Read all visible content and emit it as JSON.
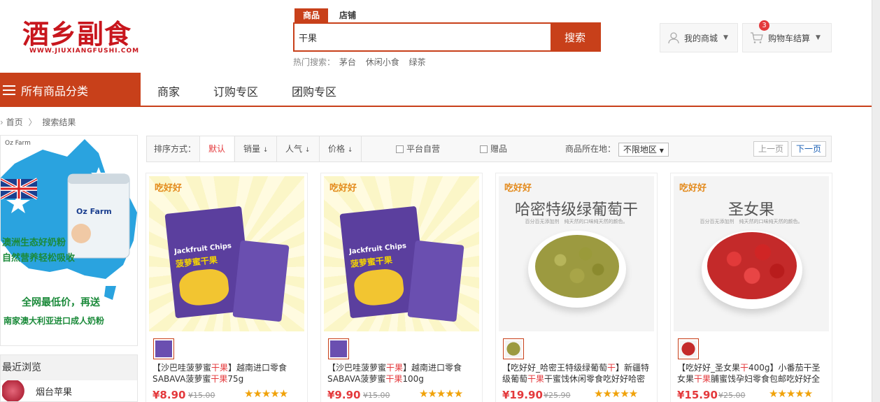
{
  "logo": {
    "text": "酒乡副食",
    "url": "WWW.JIUXIANGFUSHI.COM"
  },
  "search": {
    "tabs": [
      "商品",
      "店铺"
    ],
    "value": "干果",
    "button": "搜索",
    "hot_label": "热门搜索：",
    "hot_terms": [
      "茅台",
      "休闲小食",
      "绿茶"
    ]
  },
  "header": {
    "my_mall": "我的商城",
    "cart": "购物车结算",
    "cart_count": "3"
  },
  "nav": {
    "all_categories": "所有商品分类",
    "items": [
      "商家",
      "订购专区",
      "团购专区"
    ]
  },
  "breadcrumb": {
    "home": "首页",
    "current": "搜索结果"
  },
  "sidebar": {
    "ad": {
      "brand": "Oz Farm",
      "can_brand": "Oz Farm",
      "line1": "澳洲生态好奶粉",
      "line2": "自然营养轻松吸收",
      "line3": "全网最低价，再送",
      "line4": "南家澳大利亚进口成人奶粉"
    },
    "recent_title": "最近浏览",
    "recent_items": [
      "烟台苹果"
    ]
  },
  "sortbar": {
    "label": "排序方式：",
    "options": [
      "默认",
      "销量",
      "人气",
      "价格"
    ],
    "checkbox1": "平台自营",
    "checkbox2": "赠品",
    "location_label": "商品所在地：",
    "location_value": "不限地区",
    "prev": "上一页",
    "next": "下一页"
  },
  "products": [
    {
      "title_a": "【沙巴哇菠萝蜜",
      "title_hl": "干果",
      "title_b": "】越南进口零食SABAVA菠萝蜜",
      "title_hl2": "干果",
      "title_c": "75g",
      "price": "¥8.90",
      "old_price": "¥15.00",
      "stars": "★★★★★",
      "image": {
        "brand": "吃好好",
        "name": "",
        "sub": "",
        "pack_label": "Jackfruit Chips",
        "pack_cn": "菠萝蜜干果",
        "color": "#5b3f9e"
      }
    },
    {
      "title_a": "【沙巴哇菠萝蜜",
      "title_hl": "干果",
      "title_b": "】越南进口零食SABAVA菠萝蜜",
      "title_hl2": "干果",
      "title_c": "100g",
      "price": "¥9.90",
      "old_price": "¥15.00",
      "stars": "★★★★★",
      "image": {
        "brand": "吃好好",
        "name": "",
        "sub": "",
        "pack_label": "Jackfruit Chips",
        "pack_cn": "菠萝蜜干果",
        "color": "#5b3f9e"
      }
    },
    {
      "title_a": "【吃好好_哈密王特级绿葡萄",
      "title_hl": "干",
      "title_b": "】新疆特级葡萄",
      "title_hl2": "干果",
      "title_c": "干蜜饯休闲零食吃好好哈密",
      "price": "¥19.90",
      "old_price": "¥25.90",
      "stars": "★★★★★",
      "image": {
        "brand": "吃好好",
        "name": "哈密特级绿葡萄干",
        "sub": "百分百无添加剂　纯天然的口味纯天然的颜色。",
        "color": "#8a8a2a"
      }
    },
    {
      "title_a": "【吃好好_圣女果",
      "title_hl": "干",
      "title_b": "400g】小番茄干圣女果",
      "title_hl2": "干果",
      "title_c": "脯蜜饯孕妇零食包邮吃好好全",
      "price": "¥15.90",
      "old_price": "¥25.00",
      "stars": "★★★★★",
      "image": {
        "brand": "吃好好",
        "name": "圣女果",
        "sub": "百分百无添加剂　纯天然的口味纯天然的颜色。",
        "color": "#c42a2a"
      }
    }
  ]
}
